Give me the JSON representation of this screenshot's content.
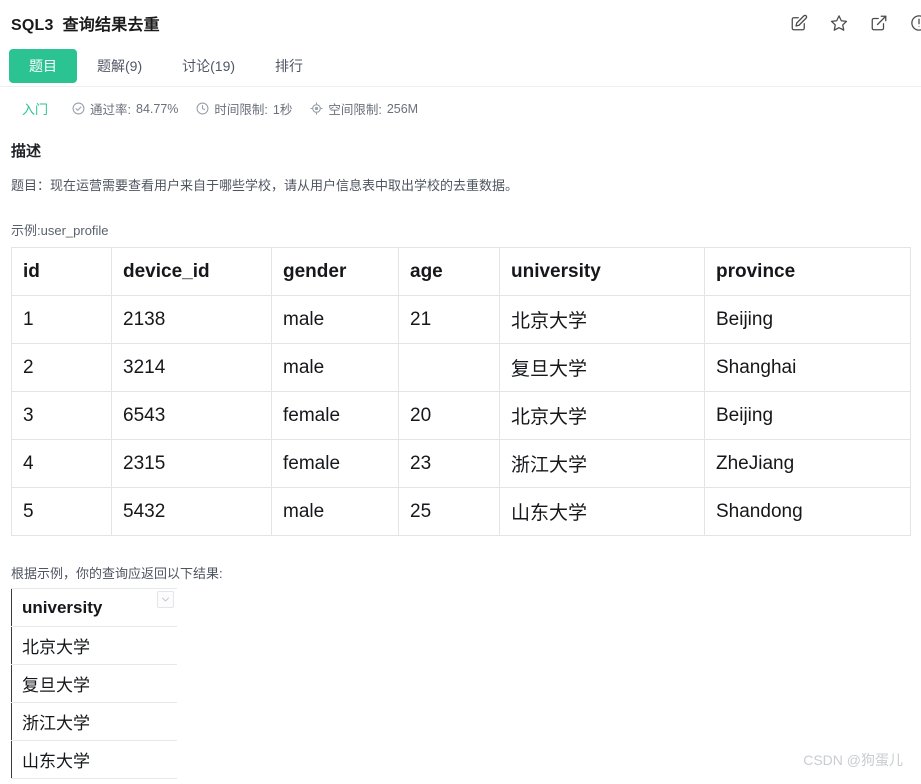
{
  "header": {
    "problem_no": "SQL3",
    "title": "查询结果去重",
    "actions": [
      {
        "name": "edit-icon",
        "label": "编辑"
      },
      {
        "name": "star-icon",
        "label": "收藏"
      },
      {
        "name": "share-icon",
        "label": "分享"
      },
      {
        "name": "info-icon",
        "label": "信息"
      }
    ]
  },
  "tabs": [
    {
      "label": "题目",
      "active": true
    },
    {
      "label": "题解(9)",
      "active": false
    },
    {
      "label": "讨论(19)",
      "active": false
    },
    {
      "label": "排行",
      "active": false
    }
  ],
  "meta": {
    "level": "入门",
    "pass_rate_label": "通过率:",
    "pass_rate_value": "84.77%",
    "time_limit_label": "时间限制:",
    "time_limit_value": "1秒",
    "space_limit_label": "空间限制:",
    "space_limit_value": "256M"
  },
  "description": {
    "section_title": "描述",
    "text": "题目：现在运营需要查看用户来自于哪些学校，请从用户信息表中取出学校的去重数据。",
    "example_label": "示例:user_profile"
  },
  "sample_table": {
    "headers": [
      "id",
      "device_id",
      "gender",
      "age",
      "university",
      "province"
    ],
    "rows": [
      [
        "1",
        "2138",
        "male",
        "21",
        "北京大学",
        "Beijing"
      ],
      [
        "2",
        "3214",
        "male",
        "",
        "复旦大学",
        "Shanghai"
      ],
      [
        "3",
        "6543",
        "female",
        "20",
        "北京大学",
        "Beijing"
      ],
      [
        "4",
        "2315",
        "female",
        "23",
        "浙江大学",
        "ZheJiang"
      ],
      [
        "5",
        "5432",
        "male",
        "25",
        "山东大学",
        "Shandong"
      ]
    ]
  },
  "result": {
    "label": "根据示例，你的查询应返回以下结果:",
    "header": "university",
    "rows": [
      "北京大学",
      "复旦大学",
      "浙江大学",
      "山东大学"
    ]
  },
  "watermark": "CSDN @狗蛋儿",
  "colors": {
    "accent_green": "#2bc392",
    "text_primary": "#1a1a1a",
    "text_secondary": "#6a6f7b",
    "border": "#e2e4e7"
  }
}
